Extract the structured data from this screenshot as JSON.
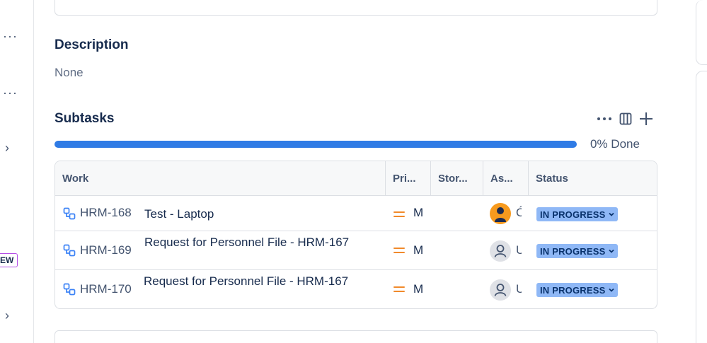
{
  "description": {
    "title": "Description",
    "value": "None"
  },
  "subtasks": {
    "title": "Subtasks",
    "progress_percent": 0,
    "progress_label": "0% Done",
    "columns": [
      "Work",
      "Pri...",
      "Stor...",
      "As...",
      "Status"
    ],
    "rows": [
      {
        "key": "HRM-168",
        "summary": "Test - Laptop",
        "priority": "M",
        "assignee_initial": "Ó",
        "avatar": "photo",
        "status": "IN PROGRESS"
      },
      {
        "key": "HRM-169",
        "summary": "Request for Personnel File - HRM-167",
        "priority": "M",
        "assignee_initial": "U",
        "avatar": "default",
        "status": "IN PROGRESS"
      },
      {
        "key": "HRM-170",
        "summary": "Request for Personnel File - HRM-167",
        "priority": "M",
        "assignee_initial": "U",
        "avatar": "default",
        "status": "IN PROGRESS"
      }
    ]
  },
  "sidebar": {
    "new_badge": "EW"
  },
  "colors": {
    "progress": "#2f7be5",
    "status_bg": "#8fb8f6",
    "priority_medium": "#f18a2b",
    "subtask_icon": "#3b82f6"
  },
  "icons": [
    "more-icon",
    "columns-icon",
    "plus-icon",
    "subtask-icon",
    "priority-medium-icon",
    "chevron-down-icon",
    "user-avatar-icon",
    "chevron-right-icon"
  ]
}
